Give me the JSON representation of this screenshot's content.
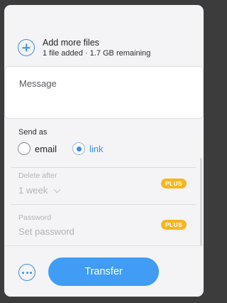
{
  "add_files": {
    "title": "Add more files",
    "subtitle": "1 file added · 1.7 GB remaining",
    "icon": "plus-circle-icon"
  },
  "message": {
    "placeholder": "Message"
  },
  "send_as": {
    "label": "Send as",
    "options": [
      {
        "label": "email",
        "selected": false
      },
      {
        "label": "link",
        "selected": true
      }
    ]
  },
  "delete_after": {
    "label": "Delete after",
    "value": "1 week",
    "badge": "PLUS",
    "icon": "chevron-down-icon"
  },
  "password": {
    "label": "Password",
    "placeholder": "Set password",
    "badge": "PLUS"
  },
  "footer": {
    "more_icon": "more-options-icon",
    "transfer_label": "Transfer"
  },
  "colors": {
    "accent": "#409cf5",
    "badge": "#f6b521",
    "background": "#f4f4f6"
  }
}
